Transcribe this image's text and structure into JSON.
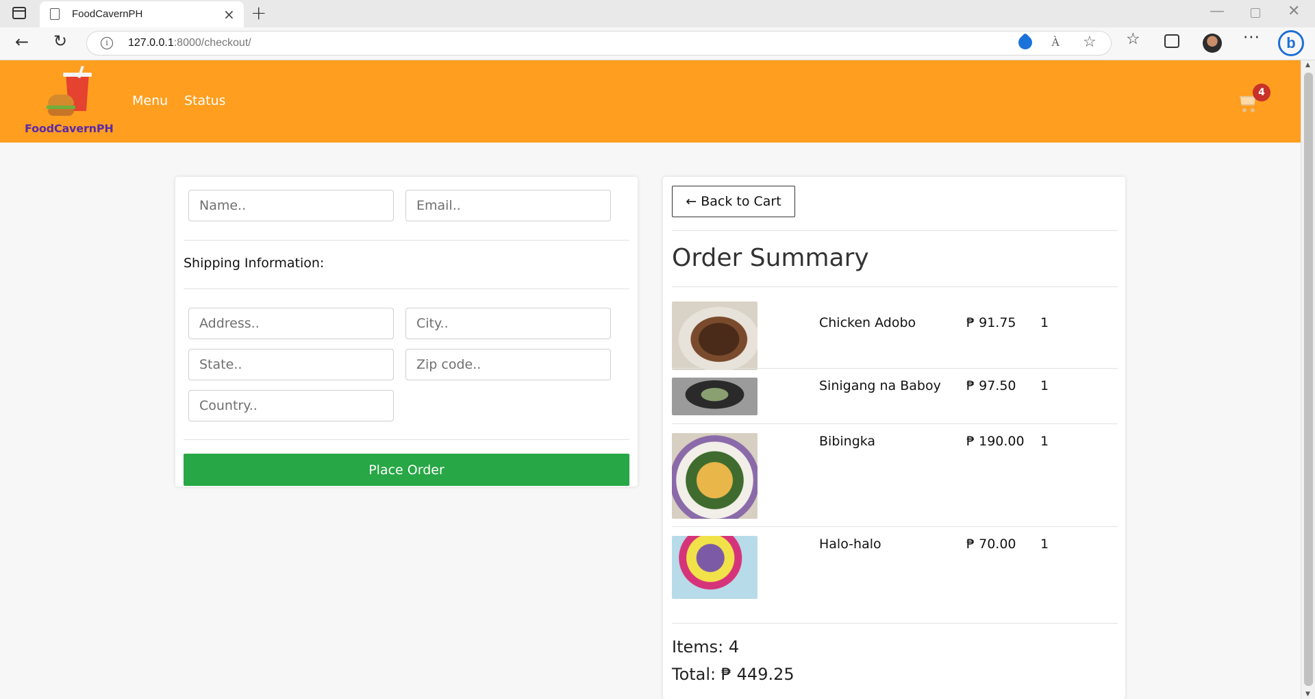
{
  "browser": {
    "tab_title": "FoodCavernPH",
    "tab_close": "×",
    "new_tab": "+",
    "url_host": "127.0.0.1",
    "url_path": ":8000/checkout/",
    "read_aloud": "À",
    "icons": [
      "sidebar-toggle-icon",
      "page-icon",
      "back-arrow-icon",
      "reload-icon",
      "info-icon",
      "tag-icon",
      "read-aloud-icon",
      "add-favorite-icon",
      "favorites-icon",
      "collections-icon",
      "profile-avatar",
      "more-icon",
      "bing-icon"
    ]
  },
  "site": {
    "logo_text": "FoodCavernPH",
    "nav": {
      "menu": "Menu",
      "status": "Status"
    },
    "cart_count": "4",
    "colors": {
      "header": "#ff9e1f",
      "place_order": "#27a745",
      "badge": "#c8322a"
    }
  },
  "checkout_form": {
    "name_placeholder": "Name..",
    "email_placeholder": "Email..",
    "shipping_label": "Shipping Information:",
    "address_placeholder": "Address..",
    "city_placeholder": "City..",
    "state_placeholder": "State..",
    "zip_placeholder": "Zip code..",
    "country_placeholder": "Country..",
    "place_order_label": "Place Order"
  },
  "summary": {
    "back_label": "← Back to Cart",
    "title": "Order Summary",
    "items": [
      {
        "name": "Chicken Adobo",
        "price": "₱ 91.75",
        "qty": "1"
      },
      {
        "name": "Sinigang na Baboy",
        "price": "₱ 97.50",
        "qty": "1"
      },
      {
        "name": "Bibingka",
        "price": "₱ 190.00",
        "qty": "1"
      },
      {
        "name": "Halo-halo",
        "price": "₱ 70.00",
        "qty": "1"
      }
    ],
    "items_count": "Items: 4",
    "total": "Total: ₱ 449.25"
  }
}
